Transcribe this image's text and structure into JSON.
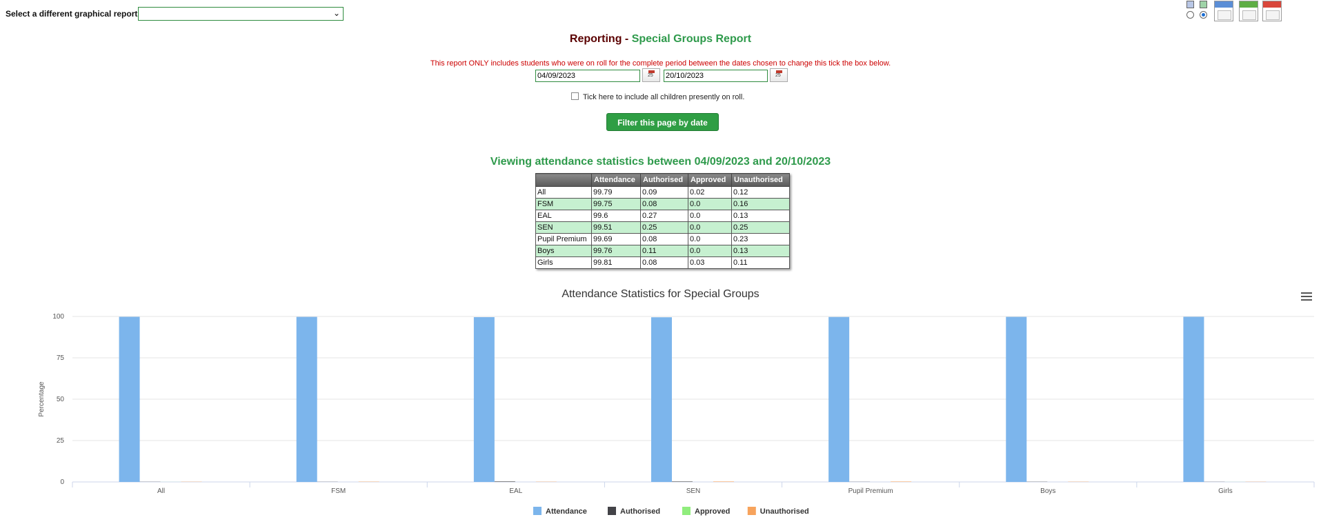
{
  "selector": {
    "label": "Select a different graphical report:",
    "value": ""
  },
  "title": {
    "prefix": "Reporting - ",
    "name": "Special Groups Report"
  },
  "notice": "This report ONLY includes students who were on roll for the complete period between the dates chosen to change this tick the box below.",
  "dates": {
    "from": "04/09/2023",
    "to": "20/10/2023",
    "calendar_icon_text": "25"
  },
  "include_checkbox": {
    "label": "Tick here to include all children presently on roll.",
    "checked": false
  },
  "filter_button": "Filter this page by date",
  "stats_heading": "Viewing attendance statistics between 04/09/2023 and 20/10/2023",
  "table": {
    "headers": [
      "",
      "Attendance",
      "Authorised",
      "Approved",
      "Unauthorised"
    ],
    "rows": [
      [
        "All",
        "99.79",
        "0.09",
        "0.02",
        "0.12"
      ],
      [
        "FSM",
        "99.75",
        "0.08",
        "0.0",
        "0.16"
      ],
      [
        "EAL",
        "99.6",
        "0.27",
        "0.0",
        "0.13"
      ],
      [
        "SEN",
        "99.51",
        "0.25",
        "0.0",
        "0.25"
      ],
      [
        "Pupil Premium",
        "99.69",
        "0.08",
        "0.0",
        "0.23"
      ],
      [
        "Boys",
        "99.76",
        "0.11",
        "0.0",
        "0.13"
      ],
      [
        "Girls",
        "99.81",
        "0.08",
        "0.03",
        "0.11"
      ]
    ]
  },
  "export_icons": [
    "image-view-icon",
    "word-export-icon",
    "excel-export-icon",
    "pdf-export-icon"
  ],
  "chart_data": {
    "type": "bar",
    "title": "Attendance Statistics for Special Groups",
    "ylabel": "Percentage",
    "xlabel": "",
    "ylim": [
      0,
      100
    ],
    "yticks": [
      0,
      25,
      50,
      75,
      100
    ],
    "grid": true,
    "legend_position": "bottom-center",
    "categories": [
      "All",
      "FSM",
      "EAL",
      "SEN",
      "Pupil Premium",
      "Boys",
      "Girls"
    ],
    "series": [
      {
        "name": "Attendance",
        "color": "#7cb5ec",
        "values": [
          99.79,
          99.75,
          99.6,
          99.51,
          99.69,
          99.76,
          99.81
        ]
      },
      {
        "name": "Authorised",
        "color": "#434348",
        "values": [
          0.09,
          0.08,
          0.27,
          0.25,
          0.08,
          0.11,
          0.08
        ]
      },
      {
        "name": "Approved",
        "color": "#90ed7d",
        "values": [
          0.02,
          0.0,
          0.0,
          0.0,
          0.0,
          0.0,
          0.03
        ]
      },
      {
        "name": "Unauthorised",
        "color": "#f7a35c",
        "values": [
          0.12,
          0.16,
          0.13,
          0.25,
          0.23,
          0.13,
          0.11
        ]
      }
    ]
  }
}
